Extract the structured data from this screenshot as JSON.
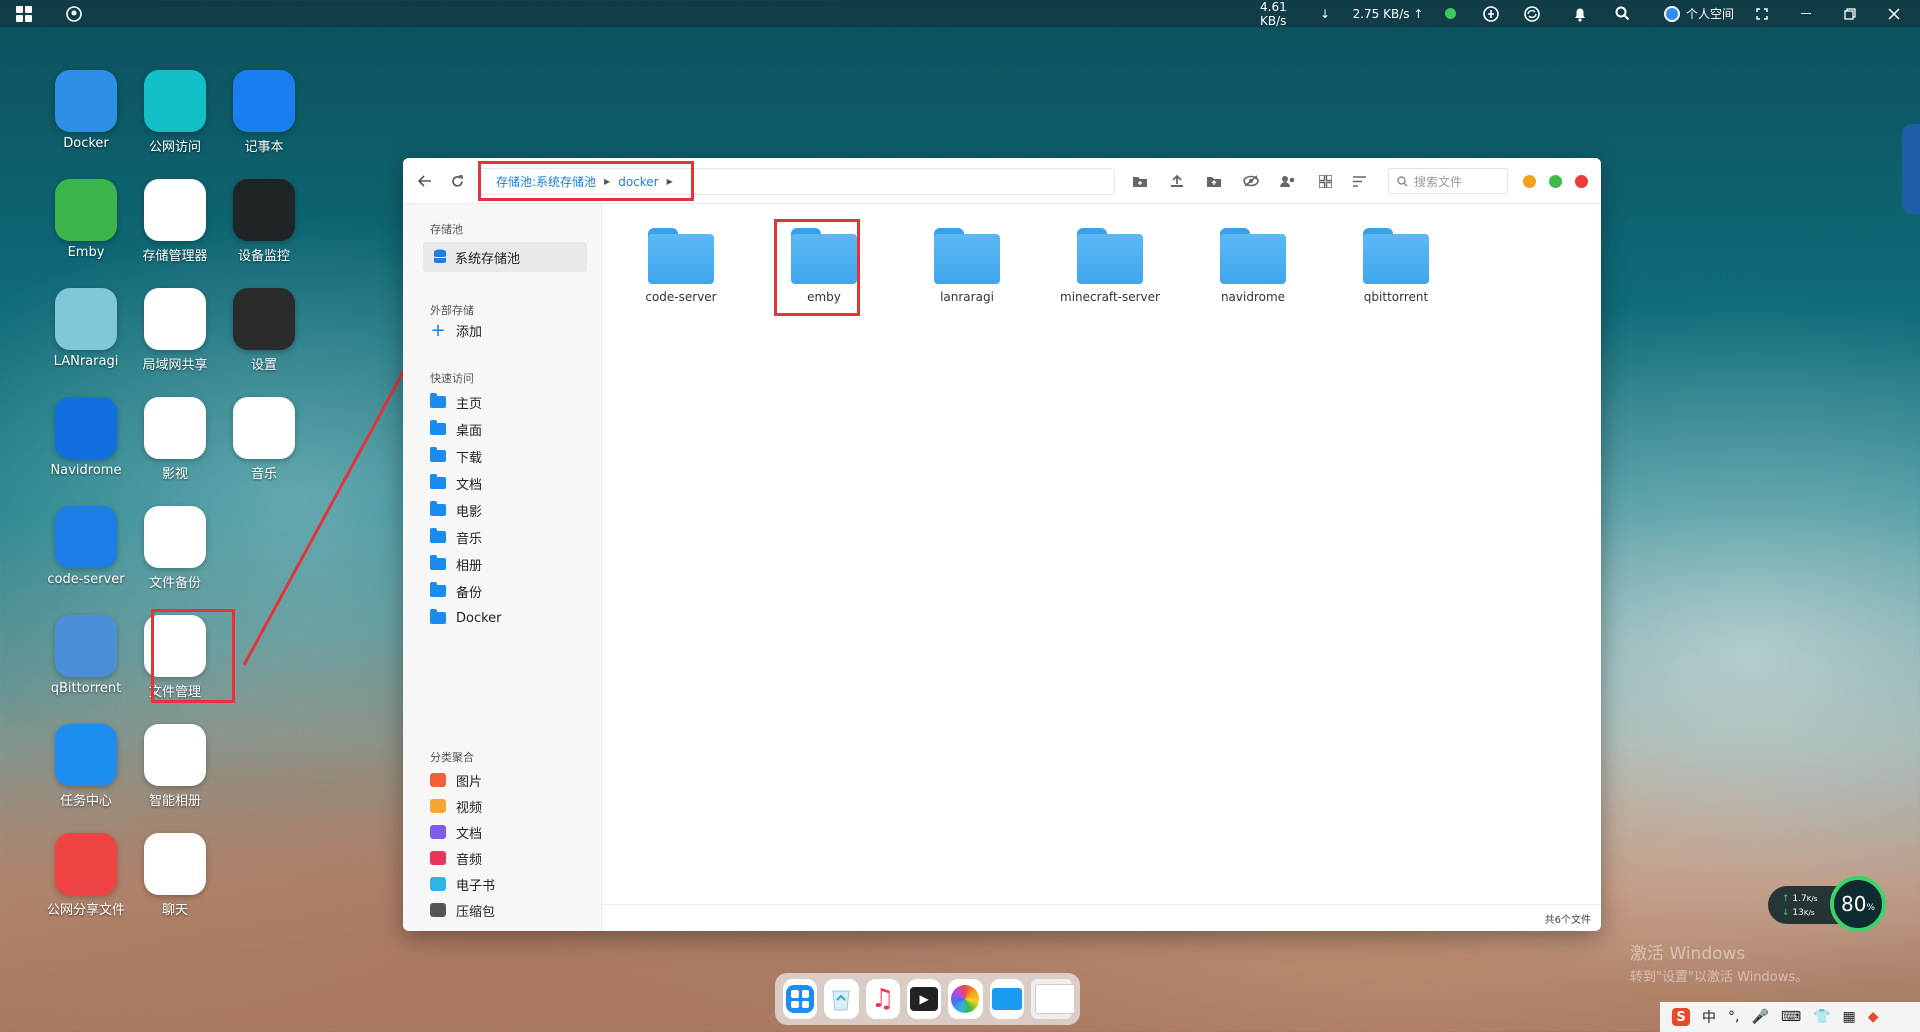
{
  "topbar": {
    "download_speed": "4.61 KB/s",
    "upload_speed": "2.75 KB/s",
    "user_label": "个人空间"
  },
  "desktop": {
    "icons": [
      {
        "label": "Docker",
        "color": "#2e8fe6"
      },
      {
        "label": "公网访问",
        "color": "#13c0c8"
      },
      {
        "label": "记事本",
        "color": "#1a7ef0"
      },
      {
        "label": "Emby",
        "color": "#3bb44a"
      },
      {
        "label": "存储管理器",
        "color": "#ffffff"
      },
      {
        "label": "设备监控",
        "color": "#1f2426"
      },
      {
        "label": "LANraragi",
        "color": "#7fc6d6"
      },
      {
        "label": "局域网共享",
        "color": "#ffffff"
      },
      {
        "label": "设置",
        "color": "#2b2b2b"
      },
      {
        "label": "Navidrome",
        "color": "#1070e0"
      },
      {
        "label": "影视",
        "color": "#ffffff"
      },
      {
        "label": "音乐",
        "color": "#ffffff"
      },
      {
        "label": "code-server",
        "color": "#1a7ee6"
      },
      {
        "label": "文件备份",
        "color": "#ffffff"
      },
      {
        "label": "qBittorrent",
        "color": "#4a8fd8"
      },
      {
        "label": "文件管理",
        "color": "#ffffff"
      },
      {
        "label": "任务中心",
        "color": "#1d8ef0"
      },
      {
        "label": "智能相册",
        "color": "#ffffff"
      },
      {
        "label": "公网分享文件",
        "color": "#f04444"
      },
      {
        "label": "聊天",
        "color": "#ffffff"
      }
    ]
  },
  "filemanager": {
    "breadcrumb": {
      "pool": "存储池:系统存储池",
      "folder": "docker"
    },
    "search_placeholder": "搜索文件",
    "sidebar": {
      "storage_title": "存储池",
      "storage_item": "系统存储池",
      "external_title": "外部存储",
      "add_label": "添加",
      "quick_title": "快速访问",
      "quick_items": [
        "主页",
        "桌面",
        "下载",
        "文档",
        "电影",
        "音乐",
        "相册",
        "备份",
        "Docker"
      ],
      "category_title": "分类聚合",
      "categories": [
        {
          "label": "图片",
          "color": "#f0603a"
        },
        {
          "label": "视频",
          "color": "#f3a535"
        },
        {
          "label": "文档",
          "color": "#7c5ce8"
        },
        {
          "label": "音频",
          "color": "#e8365a"
        },
        {
          "label": "电子书",
          "color": "#2cb5e6"
        },
        {
          "label": "压缩包",
          "color": "#555555"
        }
      ]
    },
    "files": [
      "code-server",
      "emby",
      "lanraragi",
      "minecraft-server",
      "navidrome",
      "qbittorrent"
    ],
    "status": "共6个文件"
  },
  "widget": {
    "up": "1.7",
    "down": "13",
    "unit": "K/s",
    "percent": "80",
    "percent_unit": "%"
  },
  "watermark": {
    "line1": "激活 Windows",
    "line2": "转到\"设置\"以激活 Windows。"
  },
  "taskbar": {
    "ime": "中"
  }
}
